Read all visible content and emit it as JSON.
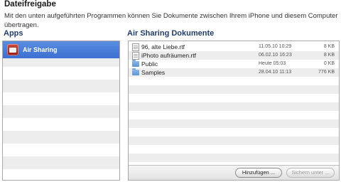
{
  "section": {
    "title": "Dateifreigabe",
    "description": "Mit den unten aufgeführten Programmen können Sie Dokumente zwischen Ihrem iPhone und diesem Computer übertragen."
  },
  "apps": {
    "heading": "Apps",
    "items": [
      {
        "label": "Air Sharing",
        "icon": "air-sharing-app-icon",
        "selected": true
      }
    ]
  },
  "documents": {
    "heading": "Air Sharing Dokumente",
    "items": [
      {
        "name": "96, alte Liebe.rtf",
        "date": "11.05.10 10:29",
        "size": "8 KB",
        "icon": "rtf-file-icon"
      },
      {
        "name": "iPhoto aufräumen.rtf",
        "date": "06.02.10 16:23",
        "size": "8 KB",
        "icon": "rtf-file-icon"
      },
      {
        "name": "Public",
        "date": "Heute 05:03",
        "size": "0 KB",
        "icon": "folder-icon"
      },
      {
        "name": "Samples",
        "date": "28.04.10 11:13",
        "size": "776 KB",
        "icon": "folder-icon"
      }
    ],
    "add_label": "Hinzufügen ...",
    "save_label": "Sichern unter ..."
  },
  "colors": {
    "selection": "#3c6fd0",
    "heading": "#1f3d6b"
  }
}
